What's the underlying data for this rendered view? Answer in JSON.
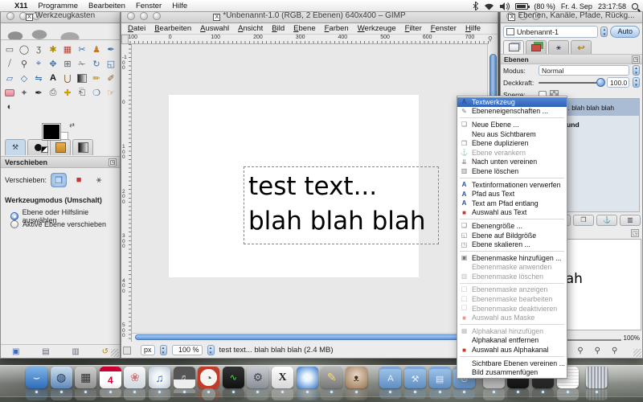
{
  "menubar": {
    "apple": "",
    "items": [
      "X11",
      "Programme",
      "Bearbeiten",
      "Fenster",
      "Hilfe"
    ],
    "status": {
      "battery_pct": "(80 %)",
      "date": "Fr. 4. Sep",
      "time": "23:17:58"
    }
  },
  "toolbox": {
    "title": "Werkzeugkasten",
    "tools": [
      {
        "name": "rectangle-select",
        "glyph": "▭",
        "color": "#555"
      },
      {
        "name": "ellipse-select",
        "glyph": "◯",
        "color": "#555"
      },
      {
        "name": "free-select",
        "glyph": "ʒ",
        "color": "#555"
      },
      {
        "name": "fuzzy-select",
        "glyph": "✱",
        "color": "#b08c00"
      },
      {
        "name": "select-by-color",
        "glyph": "▦",
        "color": "#b84030"
      },
      {
        "name": "scissors-select",
        "glyph": "✂",
        "color": "#3a6ea5"
      },
      {
        "name": "foreground-select",
        "glyph": "♟",
        "color": "#c87a2a"
      },
      {
        "name": "paths",
        "glyph": "✒",
        "color": "#3a6ea5"
      },
      {
        "name": "color-picker",
        "glyph": "⧸",
        "color": "#444"
      },
      {
        "name": "zoom",
        "glyph": "⚲",
        "color": "#444"
      },
      {
        "name": "measure",
        "glyph": "⌖",
        "color": "#3a6ea5"
      },
      {
        "name": "move",
        "glyph": "✥",
        "color": "#3a6ea5"
      },
      {
        "name": "alignment",
        "glyph": "⊞",
        "color": "#555"
      },
      {
        "name": "crop",
        "glyph": "✁",
        "color": "#777"
      },
      {
        "name": "rotate",
        "glyph": "↻",
        "color": "#3a6ea5"
      },
      {
        "name": "scale",
        "glyph": "◱",
        "color": "#3a6ea5"
      },
      {
        "name": "shear",
        "glyph": "▱",
        "color": "#3a6ea5"
      },
      {
        "name": "perspective",
        "glyph": "◇",
        "color": "#3a6ea5"
      },
      {
        "name": "flip",
        "glyph": "⇋",
        "color": "#3a6ea5"
      },
      {
        "name": "text",
        "glyph": "A",
        "color": "#111"
      },
      {
        "name": "bucket-fill",
        "glyph": "⋃",
        "color": "#8a5a2a"
      },
      {
        "name": "blend",
        "glyph": "",
        "color": "gradient"
      },
      {
        "name": "pencil",
        "glyph": "✏",
        "color": "#b8860b"
      },
      {
        "name": "paintbrush",
        "glyph": "✐",
        "color": "#8a5a2a"
      },
      {
        "name": "eraser",
        "glyph": "",
        "color": "eraser"
      },
      {
        "name": "airbrush",
        "glyph": "✦",
        "color": "#666"
      },
      {
        "name": "ink",
        "glyph": "✒",
        "color": "#222"
      },
      {
        "name": "clone",
        "glyph": "⎙",
        "color": "#555"
      },
      {
        "name": "heal",
        "glyph": "✚",
        "color": "#c8a000"
      },
      {
        "name": "perspective-clone",
        "glyph": "⎗",
        "color": "#555"
      },
      {
        "name": "blur-sharpen",
        "glyph": "❍",
        "color": "#3a6ea5"
      },
      {
        "name": "smudge",
        "glyph": "☞",
        "color": "#c87a2a"
      },
      {
        "name": "dodge-burn",
        "glyph": "◐",
        "color": "#333"
      }
    ],
    "options": {
      "panel_title": "Verschieben",
      "move_label": "Verschieben:",
      "mode_heading": "Werkzeugmodus (Umschalt)",
      "radio1": "Ebene oder Hilfslinie auswählen",
      "radio2": "Aktive Ebene verschieben"
    }
  },
  "image_window": {
    "title": "*Unbenannt-1.0 (RGB, 2 Ebenen) 640x400 – GIMP",
    "menu": [
      "Datei",
      "Bearbeiten",
      "Auswahl",
      "Ansicht",
      "Bild",
      "Ebene",
      "Farben",
      "Werkzeuge",
      "Filter",
      "Fenster",
      "Hilfe"
    ],
    "ruler_h": [
      "-100",
      "0",
      "100",
      "200",
      "300",
      "400",
      "500",
      "600",
      "700"
    ],
    "ruler_v": [
      "-100",
      "0",
      "100",
      "200",
      "300",
      "400",
      "500"
    ],
    "canvas": {
      "line1": "test text...",
      "line2": "blah blah blah"
    },
    "statusbar": {
      "unit": "px",
      "zoom": "100 %",
      "status": "test text... blah blah blah (2.4 MB)"
    }
  },
  "layers_panel": {
    "title": "Ebenen, Kanäle, Pfade, Rückg...",
    "image_select": "Unbenannt-1",
    "auto_button": "Auto",
    "section_title": "Ebenen",
    "mode_label": "Modus:",
    "mode_value": "Normal",
    "opacity_label": "Deckkraft:",
    "opacity_value": "100.0",
    "lock_label": "Sperre:",
    "layers": [
      {
        "name": "test text... blah blah blah",
        "type": "text"
      },
      {
        "name": "Hintergrund",
        "type": "image"
      }
    ],
    "nav": {
      "zoom": "100%",
      "preview_line1": "t...",
      "preview_line2": "h blah"
    }
  },
  "context_menu": {
    "items": [
      {
        "label": "Textwerkzeug",
        "icon": "text-tool",
        "selected": true
      },
      {
        "label": "Ebeneneigenschaften ...",
        "icon": "properties"
      },
      "-",
      {
        "label": "Neue Ebene ...",
        "icon": "new-layer"
      },
      {
        "label": "Neu aus Sichtbarem",
        "icon": "none"
      },
      {
        "label": "Ebene duplizieren",
        "icon": "duplicate"
      },
      {
        "label": "Ebene verankern",
        "icon": "anchor",
        "enabled": false
      },
      {
        "label": "Nach unten vereinen",
        "icon": "merge-down"
      },
      {
        "label": "Ebene löschen",
        "icon": "trash"
      },
      "-",
      {
        "label": "Textinformationen verwerfen",
        "icon": "text"
      },
      {
        "label": "Pfad aus Text",
        "icon": "text"
      },
      {
        "label": "Text am Pfad entlang",
        "icon": "text"
      },
      {
        "label": "Auswahl aus Text",
        "icon": "selection"
      },
      "-",
      {
        "label": "Ebenengröße ...",
        "icon": "layer-size"
      },
      {
        "label": "Ebene auf Bildgröße",
        "icon": "layer-to-image"
      },
      {
        "label": "Ebene skalieren ...",
        "icon": "scale"
      },
      "-",
      {
        "label": "Ebenenmaske hinzufügen ...",
        "icon": "mask-add"
      },
      {
        "label": "Ebenenmaske anwenden",
        "icon": "none",
        "enabled": false
      },
      {
        "label": "Ebenenmaske löschen",
        "icon": "trash",
        "enabled": false
      },
      "-",
      {
        "label": "Ebenenmaske anzeigen",
        "icon": "checkbox",
        "enabled": false
      },
      {
        "label": "Ebenenmaske bearbeiten",
        "icon": "checkbox",
        "enabled": false
      },
      {
        "label": "Ebenenmaske deaktivieren",
        "icon": "checkbox",
        "enabled": false
      },
      {
        "label": "Auswahl aus Maske",
        "icon": "selection",
        "enabled": false
      },
      "-",
      {
        "label": "Alphakanal hinzufügen",
        "icon": "checker",
        "enabled": false
      },
      {
        "label": "Alphakanal entfernen",
        "icon": "none"
      },
      {
        "label": "Auswahl aus Alphakanal",
        "icon": "selection"
      },
      "-",
      {
        "label": "Sichtbare Ebenen vereinen ...",
        "icon": "none"
      },
      {
        "label": "Bild zusammenfügen",
        "icon": "none"
      }
    ]
  },
  "icons": {
    "text-tool": "A",
    "properties": "✎",
    "new-layer": "❏",
    "duplicate": "❐",
    "anchor": "⚓",
    "merge-down": "⇊",
    "trash": "▥",
    "text": "A",
    "selection": "■",
    "layer-size": "❑",
    "layer-to-image": "◱",
    "scale": "◳",
    "mask-add": "▣",
    "checkbox": "☐",
    "checker": "▦",
    "none": "",
    "x_window": "X",
    "calendar_day": "4"
  },
  "dock": {
    "items": [
      {
        "name": "finder",
        "cls": "d-finder",
        "glyph": "⌣"
      },
      {
        "name": "camino-browser",
        "cls": "d-globe",
        "glyph": "◍"
      },
      {
        "name": "calculator",
        "cls": "d-calc",
        "glyph": "▦"
      },
      {
        "name": "ical",
        "cls": "d-ical",
        "glyph": "4"
      },
      {
        "name": "iphoto",
        "cls": "d-iphoto",
        "glyph": "❀"
      },
      {
        "name": "itunes",
        "cls": "d-itunes",
        "glyph": "♫"
      },
      {
        "name": "garageband",
        "cls": "d-gband",
        "glyph": "♬"
      },
      {
        "name": "timer",
        "cls": "d-timer",
        "glyph": "◔"
      },
      {
        "name": "activity-monitor",
        "cls": "d-activity",
        "glyph": "∿"
      },
      {
        "name": "colorsync",
        "cls": "d-gear",
        "glyph": "⚙"
      },
      {
        "name": "x11",
        "cls": "d-x11",
        "glyph": "X"
      },
      {
        "name": "safari",
        "cls": "d-safari",
        "glyph": "✧"
      },
      {
        "name": "art-tool",
        "cls": "d-art",
        "glyph": "✎"
      },
      {
        "name": "gimp",
        "cls": "d-gimp",
        "glyph": "ᴥ"
      },
      {
        "name": "folder-applications",
        "cls": "d-folder",
        "glyph": "A"
      },
      {
        "name": "folder-utilities",
        "cls": "d-folder",
        "glyph": "⚒"
      },
      {
        "name": "folder-documents",
        "cls": "d-folder",
        "glyph": "▤"
      },
      {
        "name": "folder-shared",
        "cls": "d-folder",
        "glyph": "⊙"
      },
      {
        "name": "minimized-window",
        "cls": "d-thumb1",
        "glyph": ""
      },
      {
        "name": "minimized-window",
        "cls": "d-thumb2",
        "glyph": ""
      },
      {
        "name": "minimized-window",
        "cls": "d-thumb3",
        "glyph": ""
      },
      {
        "name": "minimized-sheet",
        "cls": "d-sheet",
        "glyph": ""
      },
      {
        "name": "trash",
        "cls": "d-trash",
        "glyph": ""
      }
    ]
  },
  "colors": {
    "highlight": "#3a76d6",
    "selected_row": "#a9bcd4",
    "aqua": "#5d94d6"
  }
}
